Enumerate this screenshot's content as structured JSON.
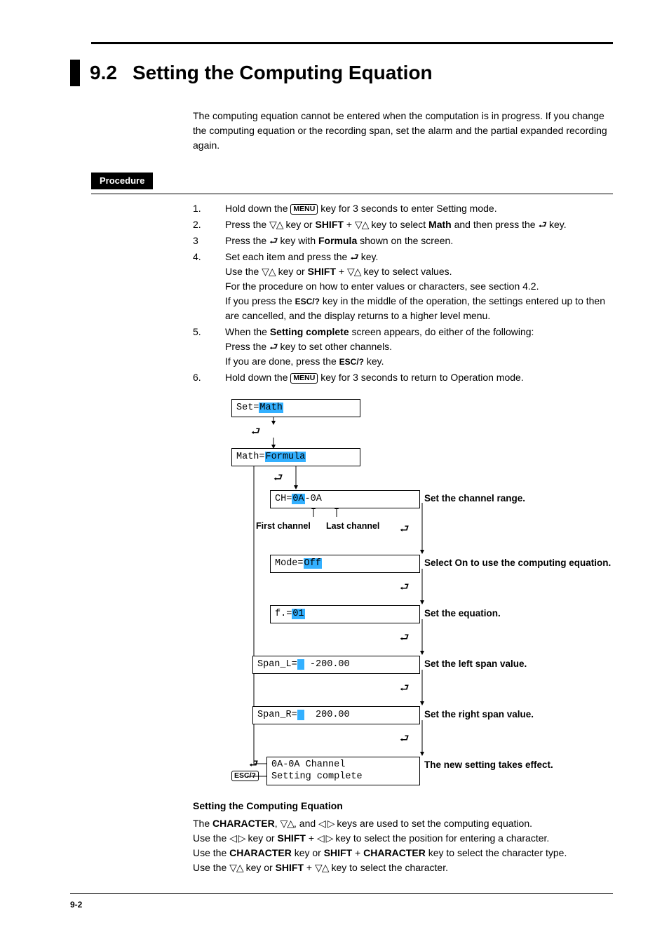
{
  "header": {
    "section_number": "9.2",
    "title": "Setting the Computing Equation"
  },
  "intro": "The computing equation cannot be entered when the computation is in progress. If you change the computing equation or the recording span, set the alarm and the partial expanded recording again.",
  "procedure_label": "Procedure",
  "keys": {
    "menu": "MENU",
    "esc": "ESC/?",
    "shift": "SHIFT",
    "character": "CHARACTER",
    "updown": "▽△",
    "leftright": "◁ ▷",
    "enter": "⏎"
  },
  "steps": [
    {
      "n": "1.",
      "pre": "Hold down the ",
      "key": "menu",
      "post": " key for 3 seconds to enter Setting mode."
    },
    {
      "n": "2.",
      "text_a": "Press the ",
      "text_b": " key or ",
      "text_c": " + ",
      "text_d": " key to select ",
      "bold": "Math",
      "text_e": " and then press the ",
      "text_f": " key."
    },
    {
      "n": "3",
      "text_a": "Press the ",
      "text_b": " key with ",
      "bold": "Formula",
      "text_c": " shown on the screen."
    },
    {
      "n": "4.",
      "lines": [
        "Set each item and press the ⏎ key.",
        "Use the ▽△ key or SHIFT + ▽△ key to select values.",
        "For the procedure on how to enter values or characters, see section 4.2.",
        "If you press the ESC/? key in the middle of the operation, the settings entered up to then are cancelled, and the display returns to a higher level menu."
      ]
    },
    {
      "n": "5.",
      "text_a": "When the ",
      "bold": "Setting complete",
      "lines": [
        " screen appears, do either of the following:",
        "Press the ⏎ key to set other channels.",
        "If you are done, press the ESC/? key."
      ]
    },
    {
      "n": "6.",
      "pre": "Hold down the ",
      "key": "menu",
      "post": " key for 3 seconds to return to Operation mode."
    }
  ],
  "diagram": {
    "boxes": {
      "set": {
        "plain": "Set=",
        "hl": "Math"
      },
      "math": {
        "plain": "Math=",
        "hl": "Formula"
      },
      "ch": {
        "plain": "CH=",
        "hl": "0A",
        "tail": "-0A"
      },
      "mode": {
        "plain": "Mode=",
        "hl": "Off"
      },
      "f": {
        "plain": "f.=",
        "hl": "01"
      },
      "spanl": {
        "plain": "Span_L=",
        "hl": " ",
        "tail": " -200.00"
      },
      "spanr": {
        "plain": "Span_R=",
        "hl": " ",
        "tail": "  200.00"
      },
      "done1": "0A-0A Channel",
      "done2": "Setting complete"
    },
    "notes": {
      "first": "First channel",
      "last": "Last channel",
      "ch": "Set the channel range.",
      "mode": "Select On to use the computing equation.",
      "f": "Set the equation.",
      "spanl": "Set the left span value.",
      "spanr": "Set the right span value.",
      "done": "The new setting takes effect."
    },
    "esc_key": "ESC/?"
  },
  "bottom": {
    "heading": "Setting the Computing Equation",
    "l1a": "The ",
    "l1b": ", ",
    "l1c": ", and ",
    "l1d": " keys are used to set the computing equation.",
    "l2a": "Use the ",
    "l2b": " key or ",
    "l2c": " + ",
    "l2d": " key to select the position for entering a character.",
    "l3a": "Use the ",
    "l3b": " key or ",
    "l3c": " + ",
    "l3d": " key to select the character type.",
    "l4a": "Use the ",
    "l4b": " key or ",
    "l4c": " + ",
    "l4d": " key to select the character."
  },
  "footer": "9-2"
}
